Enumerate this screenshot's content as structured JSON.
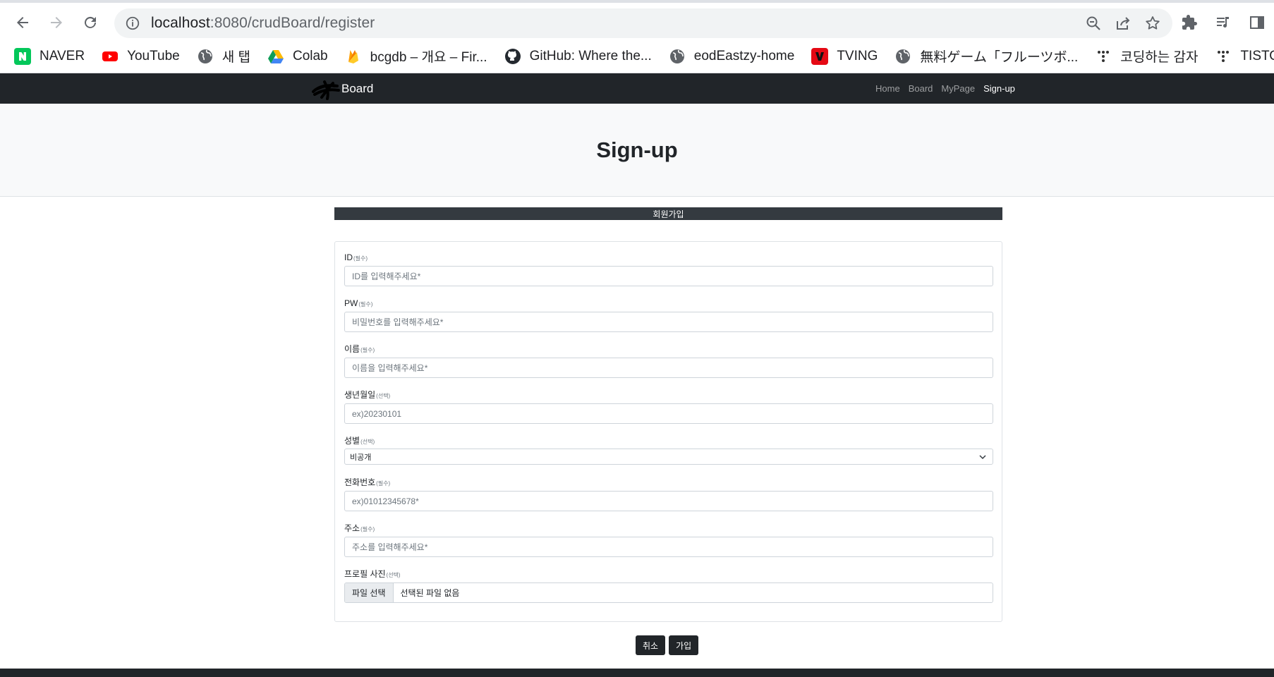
{
  "browser": {
    "url_host": "localhost",
    "url_rest": ":8080/crudBoard/register",
    "bookmarks": [
      {
        "label": "NAVER",
        "icon": "naver-icon"
      },
      {
        "label": "YouTube",
        "icon": "youtube-icon"
      },
      {
        "label": "새 탭",
        "icon": "globe-icon"
      },
      {
        "label": "Colab",
        "icon": "google-drive-icon"
      },
      {
        "label": "bcgdb – 개요 – Fir...",
        "icon": "firebase-icon"
      },
      {
        "label": "GitHub: Where the...",
        "icon": "github-icon"
      },
      {
        "label": "eodEastzy-home",
        "icon": "globe-icon"
      },
      {
        "label": "TVING",
        "icon": "tving-icon"
      },
      {
        "label": "無料ゲーム「フルーツボ...",
        "icon": "globe-icon"
      },
      {
        "label": "코딩하는 감자",
        "icon": "tistory-icon"
      },
      {
        "label": "TISTORY",
        "icon": "tistory-icon"
      }
    ]
  },
  "site": {
    "brand": "Board",
    "nav": [
      "Home",
      "Board",
      "MyPage",
      "Sign-up"
    ],
    "active_nav": "Sign-up"
  },
  "page": {
    "title": "Sign-up",
    "section_title": "회원가입"
  },
  "form": {
    "id": {
      "label": "ID",
      "tag": "(필수)",
      "placeholder": "ID를 입력해주세요*"
    },
    "pw": {
      "label": "PW",
      "tag": "(필수)",
      "placeholder": "비밀번호를 입력해주세요*"
    },
    "name": {
      "label": "이름",
      "tag": "(필수)",
      "placeholder": "이름을 입력해주세요*"
    },
    "birth": {
      "label": "생년월일",
      "tag": "(선택)",
      "placeholder": "ex)20230101"
    },
    "gender": {
      "label": "성별",
      "tag": "(선택)",
      "value": "비공개"
    },
    "phone": {
      "label": "전화번호",
      "tag": "(필수)",
      "placeholder": "ex)01012345678*"
    },
    "address": {
      "label": "주소",
      "tag": "(필수)",
      "placeholder": "주소를 입력해주세요*"
    },
    "photo": {
      "label": "프로필 사진",
      "tag": "(선택)",
      "button": "파일 선택",
      "status": "선택된 파일 없음"
    }
  },
  "actions": {
    "cancel": "취소",
    "submit": "가입"
  },
  "colors": {
    "navbar": "#212529",
    "header_bg": "#f8f9fa",
    "section_bar": "#343a40"
  }
}
